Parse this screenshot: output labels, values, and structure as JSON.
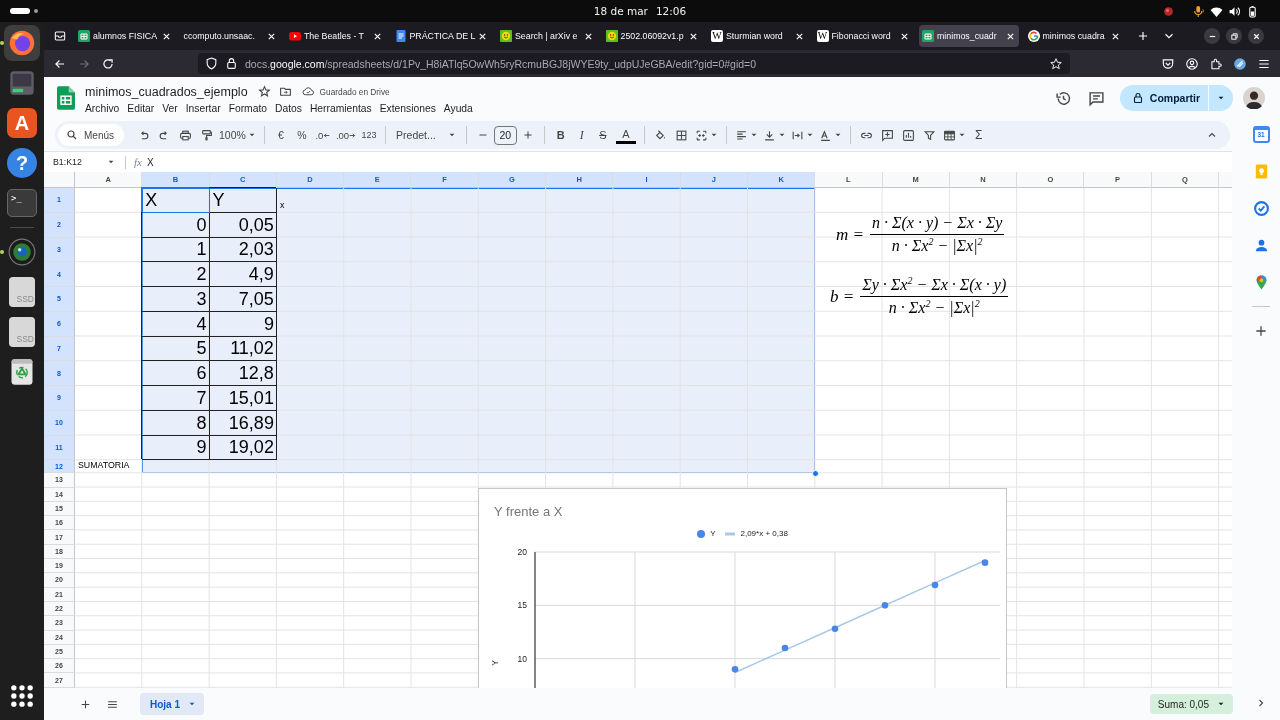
{
  "top_bar": {
    "date": "18 de mar",
    "time": "12:06"
  },
  "dock": {
    "pinned": [
      {
        "kind": "browser",
        "running": true,
        "focused": true
      },
      {
        "kind": "monitor",
        "running": false,
        "focused": false
      },
      {
        "kind": "store",
        "glyph": "A",
        "running": false,
        "focused": false
      },
      {
        "kind": "help",
        "glyph": "?",
        "running": false,
        "focused": false
      },
      {
        "kind": "terminal",
        "glyph": ">_",
        "running": false,
        "focused": false
      }
    ],
    "others": [
      {
        "kind": "camera",
        "running": true,
        "focused": false
      },
      {
        "kind": "drive",
        "glyph": "SSD",
        "running": false,
        "focused": false
      },
      {
        "kind": "drive",
        "glyph": "SSD",
        "running": false,
        "focused": false
      },
      {
        "kind": "trash",
        "running": false,
        "focused": false
      }
    ]
  },
  "browser": {
    "tabs": [
      {
        "kind": "sheets",
        "title": "alumnos FISICA",
        "selected": false
      },
      {
        "kind": "plain",
        "title": "ccomputo.unsaac.",
        "selected": false
      },
      {
        "kind": "video",
        "title": "The Beatles - T",
        "selected": false
      },
      {
        "kind": "docs",
        "title": "PRÁCTICA DE L",
        "selected": false
      },
      {
        "kind": "smiley",
        "title": "Search | arXiv e",
        "selected": false
      },
      {
        "kind": "smiley",
        "title": "2502.06092v1.p",
        "selected": false
      },
      {
        "kind": "wiki",
        "glyph": "W",
        "title": "Sturmian word",
        "selected": false
      },
      {
        "kind": "wiki",
        "glyph": "W",
        "title": "Fibonacci word",
        "selected": false
      },
      {
        "kind": "sheets",
        "title": "minimos_cuadr",
        "selected": true
      },
      {
        "kind": "google",
        "title": "minimos cuadra",
        "selected": false
      }
    ],
    "forward_disabled": true,
    "url": "docs.**google.com**/spreadsheets/d/1Pv_H8iATlq5OwWh5ryRcmuBGJ8jWYE9ty_udpUJeGBA/edit?gid=0#gid=0"
  },
  "sheets": {
    "title": "minimos_cuadrados_ejemplo",
    "starred": false,
    "save_status": "Guardado en Drive",
    "menus": [
      "Archivo",
      "Editar",
      "Ver",
      "Insertar",
      "Formato",
      "Datos",
      "Herramientas",
      "Extensiones",
      "Ayuda"
    ],
    "share_label": "Compartir",
    "toolbar": {
      "search": "Menús",
      "zoom": "100%",
      "currency": "€",
      "percent": "%",
      "decimals_less": ".0",
      "decimals_more": ".00",
      "number_format": "123",
      "font": "Predet...",
      "font_size": "20",
      "bold": "B",
      "italic": "I",
      "strikethrough": "S",
      "text_color": "A",
      "functions": "Σ"
    },
    "formula_bar": {
      "range": "B1:K12",
      "fx": "fx",
      "content": "X"
    },
    "grid": {
      "columns": [
        {
          "label": "A",
          "selected": false
        },
        {
          "label": "B",
          "selected": true
        },
        {
          "label": "C",
          "selected": true
        },
        {
          "label": "D",
          "selected": true
        },
        {
          "label": "E",
          "selected": true
        },
        {
          "label": "F",
          "selected": true
        },
        {
          "label": "G",
          "selected": true
        },
        {
          "label": "H",
          "selected": true
        },
        {
          "label": "I",
          "selected": true
        },
        {
          "label": "J",
          "selected": true
        },
        {
          "label": "K",
          "selected": true
        },
        {
          "label": "L",
          "selected": false
        },
        {
          "label": "M",
          "selected": false
        },
        {
          "label": "N",
          "selected": false
        },
        {
          "label": "O",
          "selected": false
        },
        {
          "label": "P",
          "selected": false
        },
        {
          "label": "Q",
          "selected": false
        }
      ],
      "rows": [
        {
          "label": "1",
          "selected": true,
          "cells": {
            "b": {
              "text": "X",
              "kind": "heading",
              "active": true,
              "bordered": true
            },
            "c": {
              "text": "Y",
              "kind": "heading",
              "active": false,
              "bordered": true
            },
            "d": {
              "text": "x",
              "kind": "label",
              "active": false,
              "bordered": false
            }
          }
        },
        {
          "label": "2",
          "selected": true,
          "cells": {
            "b": {
              "text": "0",
              "kind": "number",
              "active": false,
              "bordered": true
            },
            "c": {
              "text": "0,05",
              "kind": "number",
              "active": false,
              "bordered": true
            }
          }
        },
        {
          "label": "3",
          "selected": true,
          "cells": {
            "b": {
              "text": "1",
              "kind": "number",
              "active": false,
              "bordered": true
            },
            "c": {
              "text": "2,03",
              "kind": "number",
              "active": false,
              "bordered": true
            }
          }
        },
        {
          "label": "4",
          "selected": true,
          "cells": {
            "b": {
              "text": "2",
              "kind": "number",
              "active": false,
              "bordered": true
            },
            "c": {
              "text": "4,9",
              "kind": "number",
              "active": false,
              "bordered": true
            }
          }
        },
        {
          "label": "5",
          "selected": true,
          "cells": {
            "b": {
              "text": "3",
              "kind": "number",
              "active": false,
              "bordered": true
            },
            "c": {
              "text": "7,05",
              "kind": "number",
              "active": false,
              "bordered": true
            }
          }
        },
        {
          "label": "6",
          "selected": true,
          "cells": {
            "b": {
              "text": "4",
              "kind": "number",
              "active": false,
              "bordered": true
            },
            "c": {
              "text": "9",
              "kind": "number",
              "active": false,
              "bordered": true
            }
          }
        },
        {
          "label": "7",
          "selected": true,
          "cells": {
            "b": {
              "text": "5",
              "kind": "number",
              "active": false,
              "bordered": true
            },
            "c": {
              "text": "11,02",
              "kind": "number",
              "active": false,
              "bordered": true
            }
          }
        },
        {
          "label": "8",
          "selected": true,
          "cells": {
            "b": {
              "text": "6",
              "kind": "number",
              "active": false,
              "bordered": true
            },
            "c": {
              "text": "12,8",
              "kind": "number",
              "active": false,
              "bordered": true
            }
          }
        },
        {
          "label": "9",
          "selected": true,
          "cells": {
            "b": {
              "text": "7",
              "kind": "number",
              "active": false,
              "bordered": true
            },
            "c": {
              "text": "15,01",
              "kind": "number",
              "active": false,
              "bordered": true
            }
          }
        },
        {
          "label": "10",
          "selected": true,
          "cells": {
            "b": {
              "text": "8",
              "kind": "number",
              "active": false,
              "bordered": true
            },
            "c": {
              "text": "16,89",
              "kind": "number",
              "active": false,
              "bordered": true
            }
          }
        },
        {
          "label": "11",
          "selected": true,
          "cells": {
            "b": {
              "text": "9",
              "kind": "number",
              "active": false,
              "bordered": true
            },
            "c": {
              "text": "19,02",
              "kind": "number",
              "active": false,
              "bordered": true
            }
          }
        },
        {
          "label": "12",
          "selected": true,
          "cells": {
            "a": {
              "text": "SUMATORIA",
              "kind": "label",
              "active": false,
              "bordered": false
            }
          }
        },
        {
          "label": "13",
          "selected": false
        },
        {
          "label": "14",
          "selected": false
        },
        {
          "label": "15",
          "selected": false
        },
        {
          "label": "16",
          "selected": false
        },
        {
          "label": "17",
          "selected": false
        },
        {
          "label": "18",
          "selected": false
        },
        {
          "label": "19",
          "selected": false
        },
        {
          "label": "20",
          "selected": false
        },
        {
          "label": "21",
          "selected": false
        },
        {
          "label": "22",
          "selected": false
        },
        {
          "label": "23",
          "selected": false
        },
        {
          "label": "24",
          "selected": false
        },
        {
          "label": "25",
          "selected": false
        },
        {
          "label": "26",
          "selected": false
        },
        {
          "label": "27",
          "selected": false
        }
      ]
    },
    "formulas": [
      {
        "lhs": "m =",
        "numerator": "n · Σ(x · y) − Σx · Σy",
        "denominator": "n · Σx$^{2}$ − |Σx|$^{2}$"
      },
      {
        "lhs": "b =",
        "numerator": "Σy · Σx$^{2}$ − Σx · Σ(x · y)",
        "denominator": "n · Σx$^{2}$ − |Σx|$^{2}$"
      }
    ],
    "chart": {
      "chart_data": {
        "type": "scatter",
        "title": "Y frente a X",
        "ylabel": "Y",
        "legend": "top",
        "grid": true,
        "categories": [
          null,
          null,
          null,
          null,
          null,
          null
        ],
        "series": [
          {
            "name": "Y",
            "color": "#4a86e8",
            "values": [
              9,
              11,
              12.8,
              15,
              16.9,
              19
            ]
          },
          {
            "name": "2,09*x + 0,38",
            "type": "line",
            "color": "#a9c8e8",
            "values": [
              8.7,
              10.8,
              12.9,
              15,
              17.1,
              19.2
            ]
          }
        ],
        "ylim": [
          7.25,
          20
        ],
        "yticks": [
          {
            "value": 10,
            "label": "10"
          },
          {
            "value": 15,
            "label": "15"
          },
          {
            "value": 20,
            "label": "20"
          }
        ]
      }
    },
    "sheet_tabs": [
      {
        "name": "Hoja 1",
        "selected": true
      }
    ],
    "summary": "Suma: 0,05",
    "side_panel": {
      "calendar_day": "31"
    }
  }
}
